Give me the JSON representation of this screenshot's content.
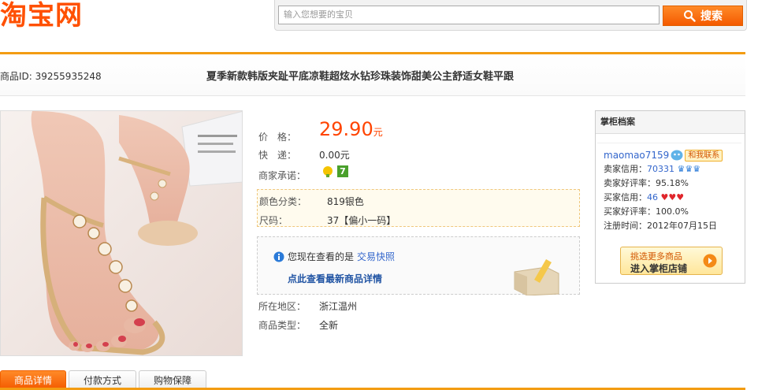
{
  "header": {
    "logo": "淘宝网",
    "search_placeholder": "输入您想要的宝贝",
    "search_button": "搜索"
  },
  "item": {
    "id_label": "商品ID: 39255935248",
    "title": "夏季新款韩版夹趾平底凉鞋超炫水钻珍珠装饰甜美公主舒适女鞋平跟"
  },
  "props": {
    "price_label": "价　格：",
    "price_value": "29.90",
    "price_unit": "元",
    "shipping_label": "快　递：",
    "shipping_value": "0.00元",
    "promise_label": "商家承诺：",
    "promise_badge": "7",
    "color_label": "颜色分类：",
    "color_value": "819银色",
    "size_label": "尺码：",
    "size_value": "37【偏小一码】",
    "snapshot_text": "您现在查看的是",
    "snapshot_link": "交易快照",
    "latest_link": "点此查看最新商品详情",
    "location_label": "所在地区：",
    "location_value": "浙江温州",
    "type_label": "商品类型：",
    "type_value": "全新"
  },
  "seller": {
    "heading": "掌柜档案",
    "name": "maomao7159",
    "contact": "和我联系",
    "seller_credit_label": "卖家信用：",
    "seller_credit": "70331",
    "seller_rate": "卖家好评率：95.18%",
    "buyer_credit_label": "买家信用：",
    "buyer_credit": "46",
    "buyer_rate": "买家好评率：100.0%",
    "reg_time": "注册时间：2012年07月15日",
    "btn_line1": "挑选更多商品",
    "btn_line2": "进入掌柜店铺"
  },
  "tabs": [
    "商品详情",
    "付款方式",
    "购物保障"
  ],
  "colors": {
    "accent": "#ff5000",
    "line": "#f39c12",
    "link": "#3366cc"
  }
}
